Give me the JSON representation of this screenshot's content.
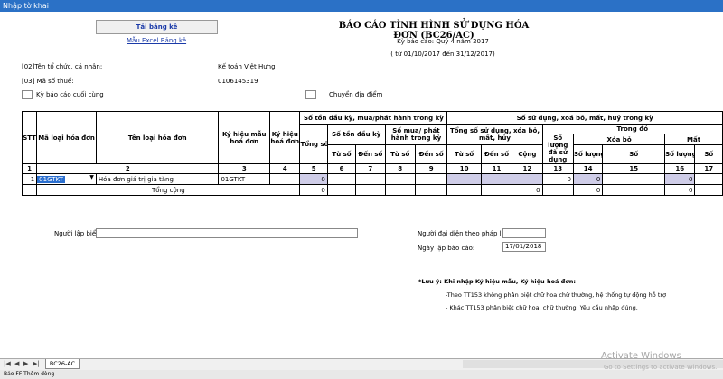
{
  "window": {
    "title": "Nhập tờ khai"
  },
  "buttons": {
    "tai_bang_ke": "Tải bảng kê",
    "mau_excel": "Mẫu Excel Bảng kê"
  },
  "report": {
    "title": "BÁO CÁO TÌNH HÌNH SỬ DỤNG HÓA ĐƠN (BC26/AC)",
    "period": "Kỳ báo cáo: Quý 4 năm 2017",
    "range": "( từ 01/10/2017 đến 31/12/2017)"
  },
  "info": {
    "org_label": "[02]Tên tổ chức, cá nhân:",
    "org_value": "Kế toán Việt Hưng",
    "tax_label": "[03]  Mã số thuế:",
    "tax_value": "0106145319",
    "last_period_label": "Kỳ báo cáo cuối cùng",
    "relocation_label": "Chuyển địa điểm"
  },
  "table": {
    "h": {
      "stt": "STT",
      "ma_loai": "Mã loại hóa đơn",
      "ten_loai": "Tên loại hóa đơn",
      "ky_hieu_mau": "Ký hiệu mẫu hoá đơn",
      "ky_hieu_hd": "Ký hiệu hoá đơn",
      "ton_dau_ky_group": "Số tồn đầu kỳ, mua/phát hành trong kỳ",
      "tong_so": "Tổng số",
      "ton_dau_ky": "Số tồn đầu kỳ",
      "mua_phat_hanh": "Số mua/ phát hành trong kỳ",
      "su_dung_group": "Số sử dụng, xoá bỏ, mất, huỷ trong kỳ",
      "tong_su_dung": "Tổng số sử dụng, xóa bỏ, mất, hủy",
      "trong_do": "Trong đó",
      "so_luong_da_su_dung": "Số lượng đã sử dụng",
      "xoa_bo": "Xóa bỏ",
      "mat": "Mất",
      "tu_so": "Từ số",
      "den_so": "Đến số",
      "cong": "Cộng",
      "so_luong": "Số lượng",
      "so": "Số"
    },
    "col_numbers": [
      "1",
      "2",
      "3",
      "4",
      "5",
      "6",
      "7",
      "8",
      "9",
      "10",
      "11",
      "12",
      "13",
      "14",
      "15",
      "16",
      "17"
    ],
    "row": {
      "stt": "1",
      "ma_loai": "01GTKT",
      "ten_loai": "Hóa đơn giá trị gia tăng",
      "ky_hieu_mau": "01GTKT",
      "c5": "0",
      "c13": "0",
      "c14": "0",
      "c16": "0"
    },
    "total": {
      "label": "Tổng cộng",
      "c5": "0",
      "c12": "0",
      "c14": "0",
      "c16": "0"
    }
  },
  "footer": {
    "nguoi_lap_label": "Người lập biểu:",
    "dai_dien_label": "Người đại diện theo pháp luật :",
    "ngay_lap_label": "Ngày lập báo cáo:",
    "ngay_lap_value": "17/01/2018"
  },
  "notes": {
    "title": "*Lưu ý: Khi nhập Ký hiệu mẫu, Ký hiệu hoá đơn:",
    "line1": "-Theo TT153 không phân biệt chữ hoa chữ thường, hệ thống tự động hỗ trợ",
    "line2": "- Khác TT153 phân biệt chữ hoa, chữ thường. Yêu cầu nhập đúng."
  },
  "sheet": {
    "tab": "BC26-AC",
    "status": "Bảo FF  Thêm dòng"
  },
  "watermark": {
    "line1": "Activate Windows",
    "line2": "Go to Settings to activate Windows."
  },
  "colors": {
    "titlebar": "#2b71c6",
    "input_highlight": "#cfcde8",
    "link": "#1a3aa8"
  }
}
